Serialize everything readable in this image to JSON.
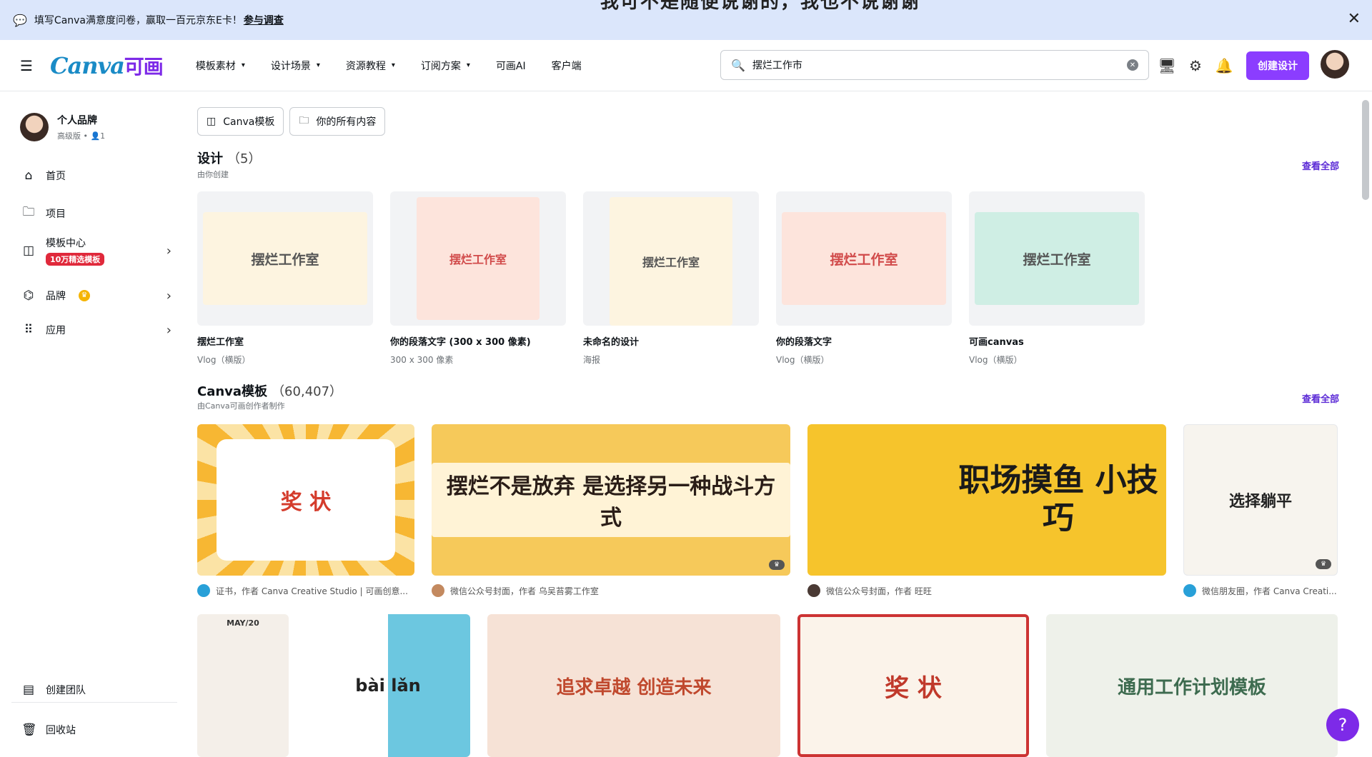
{
  "banner": {
    "message": "填写Canva满意度问卷，赢取一百元京东E卡！",
    "link": "参与调查",
    "overlay_text": "我可不是随便说谢的，我也不说谢谢"
  },
  "topbar": {
    "logo_main": "Canva",
    "logo_cn": "可画",
    "nav": [
      {
        "label": "模板素材",
        "dropdown": true
      },
      {
        "label": "设计场景",
        "dropdown": true
      },
      {
        "label": "资源教程",
        "dropdown": true
      },
      {
        "label": "订阅方案",
        "dropdown": true
      },
      {
        "label": "可画AI",
        "dropdown": false
      },
      {
        "label": "客户端",
        "dropdown": false
      }
    ],
    "search_value": "摆烂工作市",
    "create_label": "创建设计"
  },
  "sidebar": {
    "brand_name": "个人品牌",
    "brand_plan": "高级版 • 👤1",
    "items": [
      {
        "label": "首页",
        "icon": "home-icon"
      },
      {
        "label": "项目",
        "icon": "folder-icon"
      },
      {
        "label": "模板中心",
        "icon": "template-icon",
        "badge": "10万精选模板"
      },
      {
        "label": "品牌",
        "icon": "brand-icon"
      },
      {
        "label": "应用",
        "icon": "apps-icon"
      }
    ],
    "bottom": [
      {
        "label": "创建团队",
        "icon": "team-icon"
      },
      {
        "label": "回收站",
        "icon": "trash-icon"
      }
    ]
  },
  "filters": [
    "Canva模板",
    "你的所有内容"
  ],
  "designs": {
    "title": "设计",
    "count": "（5）",
    "subtitle": "由你创建",
    "view_all": "查看全部",
    "items": [
      {
        "name": "摆烂工作室",
        "meta": "Vlog（横版）",
        "thumb_text": "摆烂工作室"
      },
      {
        "name": "你的段落文字 (300 x 300 像素)",
        "meta": "300 x 300 像素",
        "thumb_text": "摆烂工作室"
      },
      {
        "name": "未命名的设计",
        "meta": "海报",
        "thumb_text": "摆烂工作室"
      },
      {
        "name": "你的段落文字",
        "meta": "Vlog（横版）",
        "thumb_text": "摆烂工作室"
      },
      {
        "name": "可画canvas",
        "meta": "Vlog（横版）",
        "thumb_text": "摆烂工作室"
      }
    ]
  },
  "templates": {
    "title": "Canva模板",
    "count": "（60,407）",
    "subtitle": "由Canva可画创作者制作",
    "view_all": "查看全部",
    "row1": [
      {
        "thumb_text": "奖 状",
        "meta": "证书，作者 Canva Creative Studio | 可画创意..."
      },
      {
        "thumb_text": "摆烂不是放弃 是选择另一种战斗方式",
        "meta": "微信公众号封面，作者 乌吴苔雾工作室"
      },
      {
        "thumb_text": "职场摸鱼 小技巧",
        "meta": "微信公众号封面，作者 旺旺"
      },
      {
        "thumb_text": "选择躺平",
        "meta": "微信朋友圈，作者 Canva Creati..."
      }
    ],
    "row2": [
      {
        "thumb_text": "MAY/20"
      },
      {
        "thumb_text": "bài lǎn"
      },
      {
        "thumb_text": "追求卓越 创造未来"
      },
      {
        "thumb_text": "奖 状"
      },
      {
        "thumb_text": "通用工作计划模板"
      }
    ]
  },
  "help_label": "?"
}
